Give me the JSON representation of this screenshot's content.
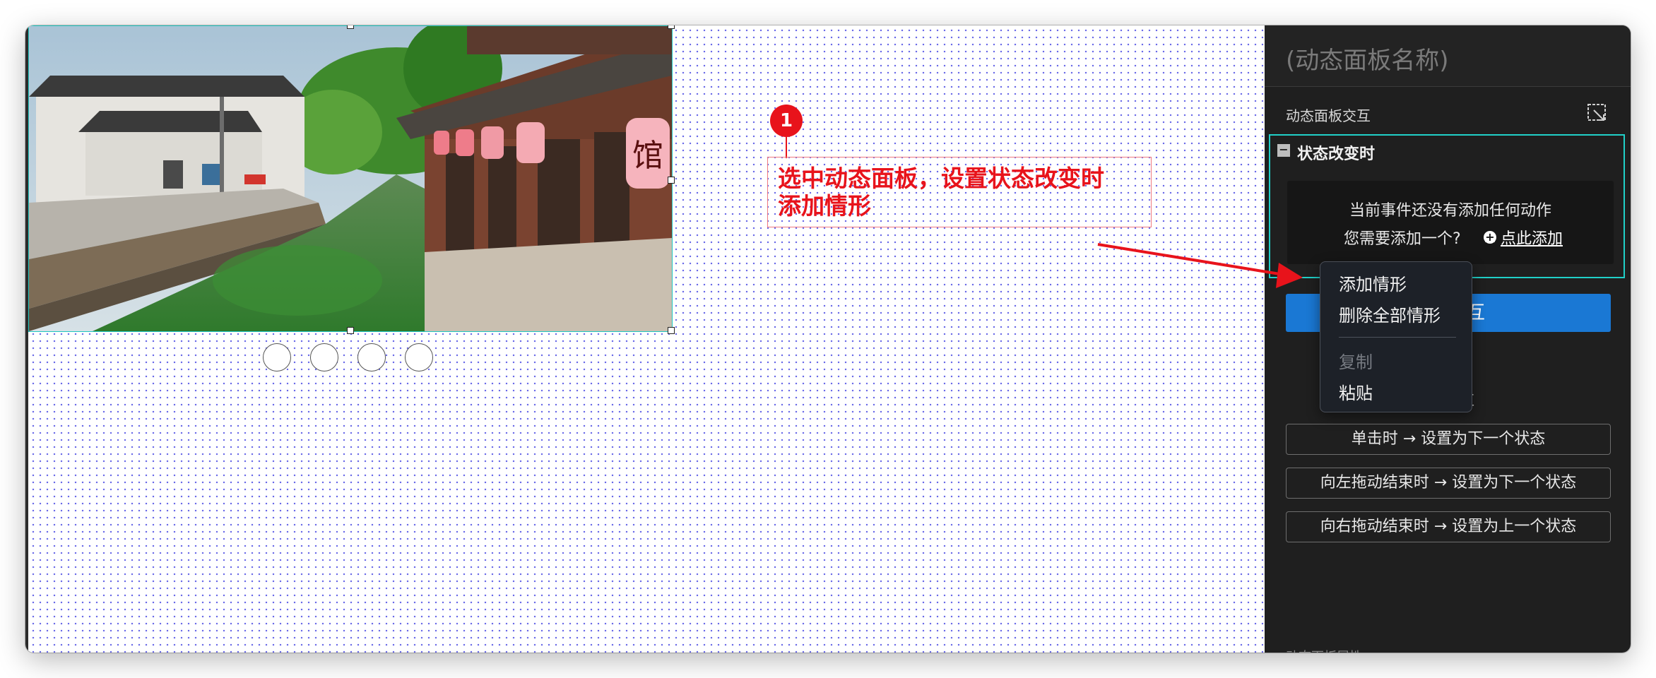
{
  "annotation": {
    "step_number": "1",
    "callout_text": "选中动态面板，设置状态改变时\n添加情形"
  },
  "panel": {
    "title_placeholder": "(动态面板名称)",
    "section_label": "动态面板交互",
    "event": {
      "title": "状态改变时",
      "empty_line1": "当前事件还没有添加任何动作",
      "empty_line2": "您需要添加一个?",
      "add_link": "点此添加"
    },
    "new_interaction_button": "新建交互",
    "common_label": "常用交互",
    "common_buttons": [
      "单击时 → 设置为下一个状态",
      "向左拖动结束时 → 设置为下一个状态",
      "向右拖动结束时 → 设置为上一个状态"
    ],
    "footer_text": "动态面板属性"
  },
  "context_menu": {
    "items": [
      "添加情形",
      "删除全部情形",
      "复制",
      "粘贴"
    ],
    "disabled": [
      false,
      false,
      true,
      false
    ]
  },
  "carousel_dots": 4,
  "colors": {
    "accent_red": "#e8131b",
    "selection_cyan": "#20d0c8",
    "panel_bg": "#1f1f1f",
    "button_blue": "#1a78d4"
  }
}
